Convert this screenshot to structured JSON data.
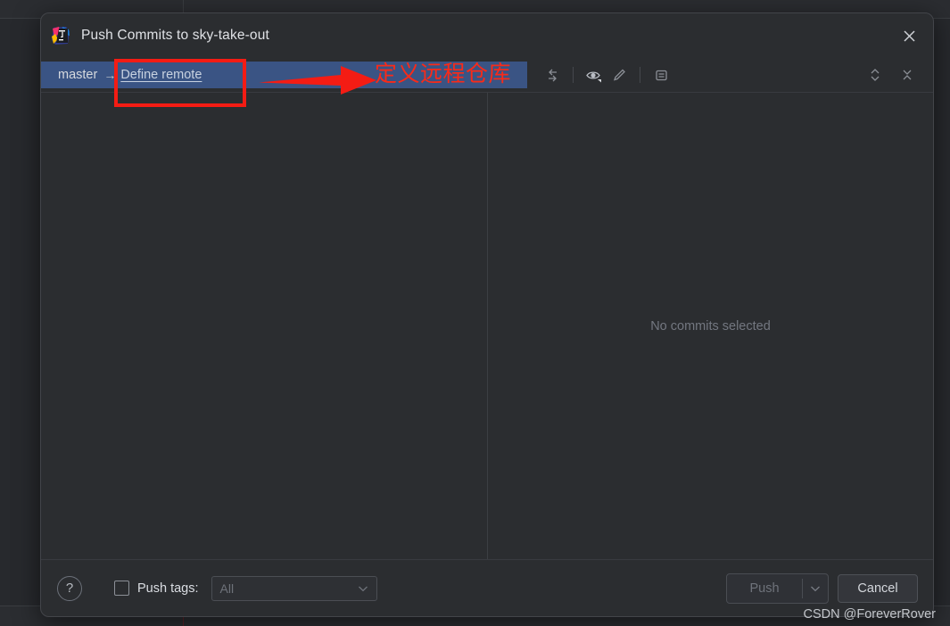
{
  "dialog": {
    "title": "Push Commits to sky-take-out",
    "app_icon": "intellij-idea-icon",
    "close_icon": "close-icon"
  },
  "branch_bar": {
    "local_branch": "master",
    "arrow_glyph": "→",
    "define_remote_link": "Define remote",
    "toolbar": [
      {
        "name": "collapse-left-icon",
        "glyph": "←"
      },
      {
        "name": "preview-eye-icon",
        "glyph": "eye"
      },
      {
        "name": "edit-pencil-icon",
        "glyph": "pencil"
      },
      {
        "name": "show-details-icon",
        "glyph": "details"
      }
    ],
    "right_toolbar": [
      {
        "name": "expand-all-icon",
        "glyph": "expand"
      },
      {
        "name": "collapse-all-icon",
        "glyph": "collapse"
      }
    ]
  },
  "main": {
    "commit_list_empty": "",
    "detail_placeholder": "No commits selected"
  },
  "footer": {
    "help_label": "?",
    "push_tags_label": "Push tags:",
    "push_tags_checked": false,
    "tags_value": "All",
    "tags_options": [
      "All"
    ],
    "push_label": "Push",
    "push_enabled": false,
    "cancel_label": "Cancel"
  },
  "annotations": {
    "chinese_note": "定义远程仓库",
    "highlight_color": "#f41c14",
    "note_color": "#fa2a18",
    "watermark": "CSDN @ForeverRover"
  },
  "colors": {
    "dialog_bg": "#2b2d30",
    "selection_blue": "#3a5484",
    "backdrop": "#27292d",
    "text_primary": "#dfe1e5",
    "text_muted": "#737780"
  }
}
